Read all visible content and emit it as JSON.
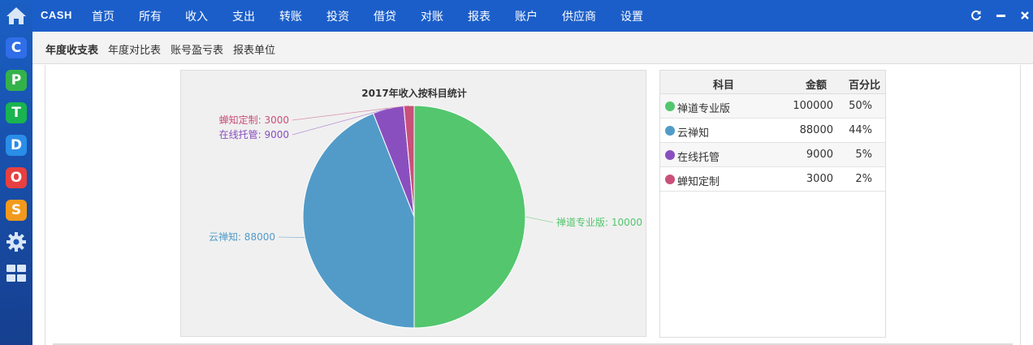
{
  "header": {
    "brand": "CASH",
    "nav": [
      "首页",
      "所有",
      "收入",
      "支出",
      "转账",
      "投资",
      "借贷",
      "对账",
      "报表",
      "账户",
      "供应商",
      "设置"
    ]
  },
  "subnav": {
    "items": [
      "年度收支表",
      "年度对比表",
      "账号盈亏表",
      "报表单位"
    ],
    "active": "年度收支表"
  },
  "dock": {
    "apps": [
      {
        "name": "home-icon"
      },
      {
        "letter": "C",
        "color": "#2f6ee8"
      },
      {
        "letter": "P",
        "color": "#34b24a"
      },
      {
        "letter": "T",
        "color": "#19b34f"
      },
      {
        "letter": "D",
        "color": "#2a8de8"
      },
      {
        "letter": "O",
        "color": "#e84040"
      },
      {
        "letter": "S",
        "color": "#f39a1d"
      },
      {
        "name": "gear-icon"
      },
      {
        "name": "grid-icon"
      }
    ]
  },
  "chart_data": {
    "type": "pie",
    "title": "2017年收入按科目统计",
    "slices": [
      {
        "label": "禅道专业版",
        "value": 100000,
        "color": "#53c66e",
        "display": "禅道专业版: 10000"
      },
      {
        "label": "云禅知",
        "value": 88000,
        "color": "#529bc8",
        "display": "云禅知: 88000"
      },
      {
        "label": "在线托管",
        "value": 9000,
        "color": "#8a4fbf",
        "display": "在线托管: 9000"
      },
      {
        "label": "蝉知定制",
        "value": 3000,
        "color": "#c9507a",
        "display": "蝉知定制: 3000"
      }
    ]
  },
  "table": {
    "headers": {
      "subject": "科目",
      "amount": "金额",
      "percent": "百分比"
    },
    "rows": [
      {
        "subject": "禅道专业版",
        "amount": "100000",
        "percent": "50%",
        "color": "#53c66e"
      },
      {
        "subject": "云禅知",
        "amount": "88000",
        "percent": "44%",
        "color": "#529bc8"
      },
      {
        "subject": "在线托管",
        "amount": "9000",
        "percent": "5%",
        "color": "#8a4fbf"
      },
      {
        "subject": "蝉知定制",
        "amount": "3000",
        "percent": "2%",
        "color": "#c9507a"
      }
    ]
  }
}
